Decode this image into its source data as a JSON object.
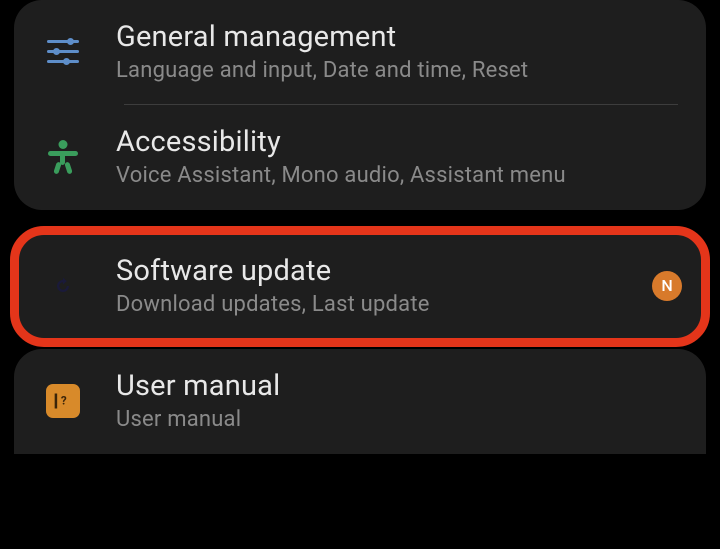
{
  "items": {
    "generalManagement": {
      "title": "General management",
      "subtitle": "Language and input, Date and time, Reset"
    },
    "accessibility": {
      "title": "Accessibility",
      "subtitle": "Voice Assistant, Mono audio, Assistant menu"
    },
    "softwareUpdate": {
      "title": "Software update",
      "subtitle": "Download updates, Last update",
      "badge": "N"
    },
    "userManual": {
      "title": "User manual",
      "subtitle": "User manual"
    }
  },
  "icons": {
    "softwareUpdateBg": "#7a7ae0",
    "userManualBg": "#d88a2a"
  }
}
